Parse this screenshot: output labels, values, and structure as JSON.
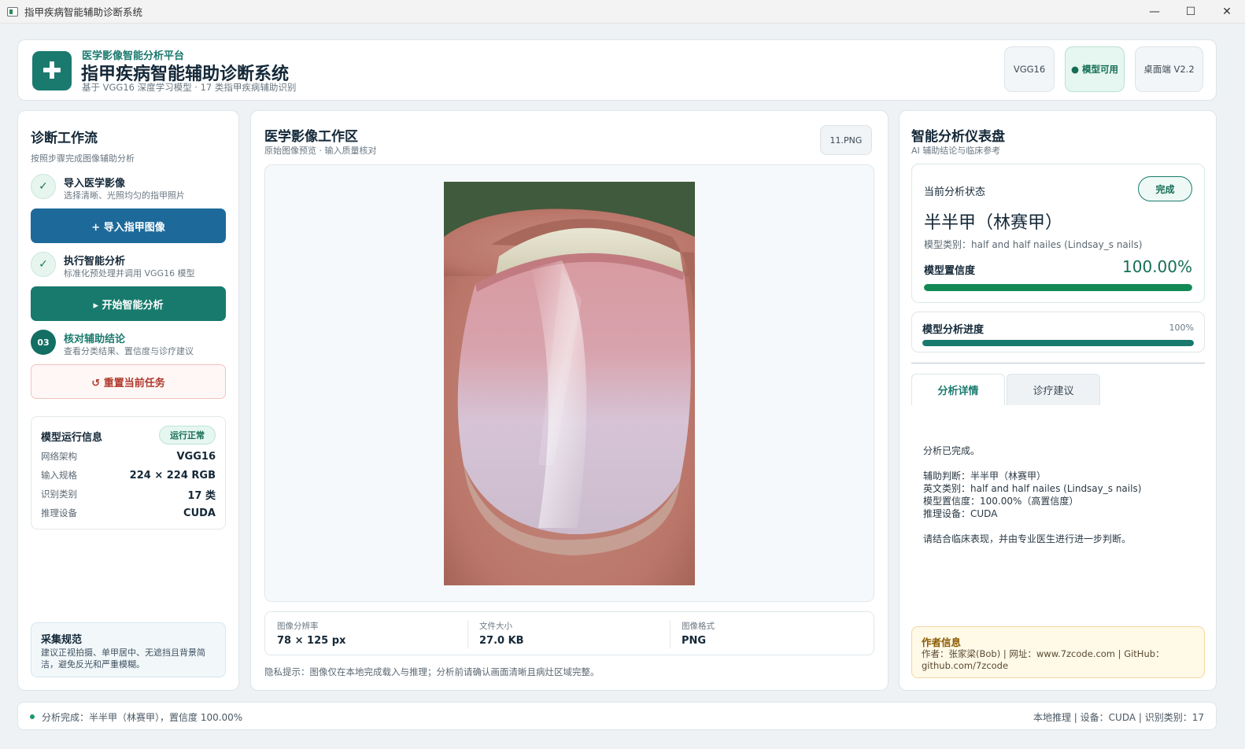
{
  "window": {
    "title": "指甲疾病智能辅助诊断系统",
    "minimize": "—",
    "maximize": "☐",
    "close": "✕"
  },
  "header": {
    "logo_glyph": "✚",
    "eyebrow": "医学影像智能分析平台",
    "title": "指甲疾病智能辅助诊断系统",
    "subtitle": "基于 VGG16 深度学习模型 · 17 类指甲疾病辅助识别",
    "pills": [
      "VGG16",
      "● 模型可用",
      "桌面端 V2.2"
    ]
  },
  "workflow": {
    "title": "诊断工作流",
    "subtitle": "按照步骤完成图像辅助分析",
    "steps": [
      {
        "marker": "✓",
        "title": "导入医学影像",
        "desc": "选择清晰、光照均匀的指甲照片"
      },
      {
        "marker": "✓",
        "title": "执行智能分析",
        "desc": "标准化预处理并调用 VGG16 模型"
      },
      {
        "marker": "03",
        "title": "核对辅助结论",
        "desc": "查看分类结果、置信度与诊疗建议"
      }
    ],
    "import_button": "+  导入指甲图像",
    "analyze_button": "▸  开始智能分析",
    "reset_button": "↺  重置当前任务"
  },
  "model_info": {
    "title": "模型运行信息",
    "status": "运行正常",
    "rows": [
      {
        "k": "网络架构",
        "v": "VGG16"
      },
      {
        "k": "输入规格",
        "v": "224 × 224 RGB"
      },
      {
        "k": "识别类别",
        "v": "17 类"
      },
      {
        "k": "推理设备",
        "v": "CUDA"
      }
    ]
  },
  "guidelines": {
    "title": "采集规范",
    "text": "建议正视拍摄、单甲居中、无遮挡且背景简洁，避免反光和严重模糊。"
  },
  "workspace": {
    "title": "医学影像工作区",
    "subtitle": "原始图像预览 · 输入质量核对",
    "file_name": "11.PNG",
    "meta": [
      {
        "label": "图像分辨率",
        "value": "78 × 125 px"
      },
      {
        "label": "文件大小",
        "value": "27.0 KB"
      },
      {
        "label": "图像格式",
        "value": "PNG"
      }
    ],
    "privacy": "隐私提示：图像仅在本地完成载入与推理；分析前请确认画面清晰且病灶区域完整。"
  },
  "dashboard": {
    "title": "智能分析仪表盘",
    "subtitle": "AI 辅助结论与临床参考",
    "status_label": "当前分析状态",
    "status_badge": "完成",
    "diagnosis": "半半甲（林赛甲）",
    "category_en": "模型类别：half and half nailes (Lindsay_s nails)",
    "confidence_label": "模型置信度",
    "confidence_value": "100.00%",
    "confidence_fraction": 1.0,
    "progress_label": "模型分析进度",
    "progress_value": "100%",
    "progress_fraction": 1.0,
    "tabs": [
      "分析详情",
      "诊疗建议"
    ],
    "details": [
      "分析已完成。",
      "",
      "辅助判断：半半甲（林赛甲）",
      "英文类别：half and half nailes (Lindsay_s nails)",
      "模型置信度：100.00%（高置信度）",
      "推理设备：CUDA",
      "",
      "请结合临床表现，并由专业医生进行进一步判断。"
    ],
    "author_title": "作者信息",
    "author_text": "作者：张家梁(Bob) | 网址：www.7zcode.com | GitHub：github.com/7zcode"
  },
  "footer": {
    "left": "分析完成：半半甲（林赛甲），置信度 100.00%",
    "right": "本地推理 | 设备：CUDA | 识别类别：17"
  },
  "colors": {
    "brand": "#1a7a6e",
    "import_button": "#1d6a9a",
    "confidence_bar": "#138a55"
  }
}
